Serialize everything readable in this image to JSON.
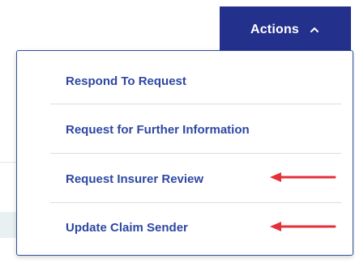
{
  "actions_button": {
    "label": "Actions",
    "icon": "chevron-up-icon",
    "background": "#23318c",
    "text_color": "#ffffff"
  },
  "menu": {
    "items": [
      {
        "label": "Respond To Request"
      },
      {
        "label": "Request for Further Information"
      },
      {
        "label": "Request Insurer Review",
        "annotated": true
      },
      {
        "label": "Update Claim Sender",
        "annotated": true
      }
    ],
    "item_color": "#2e47a3",
    "border_color": "#2f4f9c"
  },
  "annotations": {
    "arrow_color": "#e5303a",
    "arrow_icon": "red-arrow-left-icon"
  }
}
